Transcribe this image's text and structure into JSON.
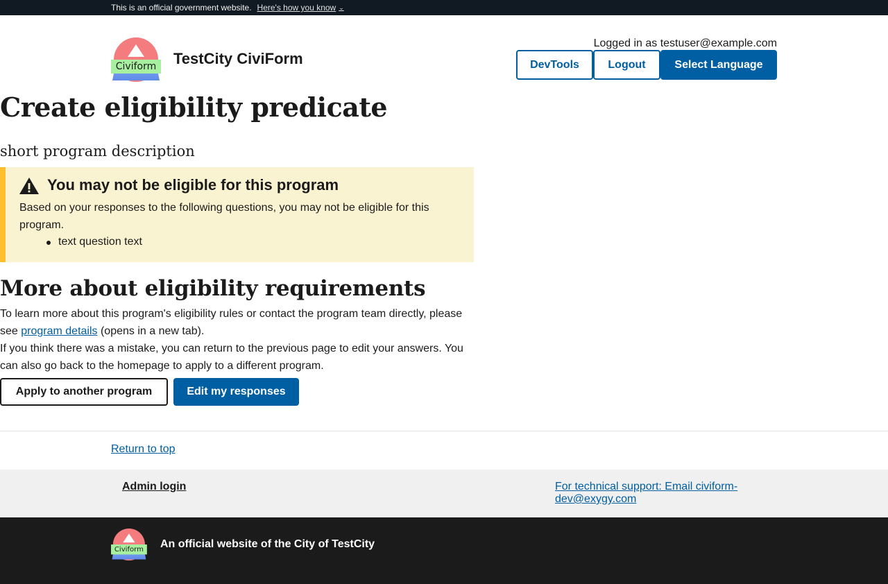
{
  "gov_banner": {
    "text": "This is an official government website.",
    "link": "Here's how you know"
  },
  "header": {
    "logo_word": "Civiform",
    "site_title": "TestCity CiviForm",
    "logged_in": "Logged in as testuser@example.com",
    "devtools": "DevTools",
    "logout": "Logout",
    "select_language": "Select Language"
  },
  "main": {
    "title": "Create eligibility predicate",
    "description": "short program description",
    "alert": {
      "heading": "You may not be eligible for this program",
      "body": "Based on your responses to the following questions, you may not be eligible for this program.",
      "items": [
        "text question text"
      ]
    },
    "section_title": "More about eligibility requirements",
    "para1_prefix": "To learn more about this program's eligibility rules or contact the program team directly, please see ",
    "para1_link": "program details",
    "para1_suffix": " (opens in a new tab).",
    "para2": "If you think there was a mistake, you can return to the previous page to edit your answers. You can also go back to the homepage to apply to a different program.",
    "apply_button": "Apply to another program",
    "edit_button": "Edit my responses"
  },
  "footer": {
    "return_to_top": "Return to top",
    "admin_login": "Admin login",
    "tech_support": "For technical support: Email civiform-dev@exygy.com",
    "logo_word": "Civiform",
    "official": "An official website of the City of TestCity"
  },
  "colors": {
    "primary": "#005ea2",
    "banner_bg": "#111a22",
    "alert_bg": "#faf3d1",
    "alert_border": "#ffbe2e",
    "footer_dark": "#1b1b1b"
  }
}
